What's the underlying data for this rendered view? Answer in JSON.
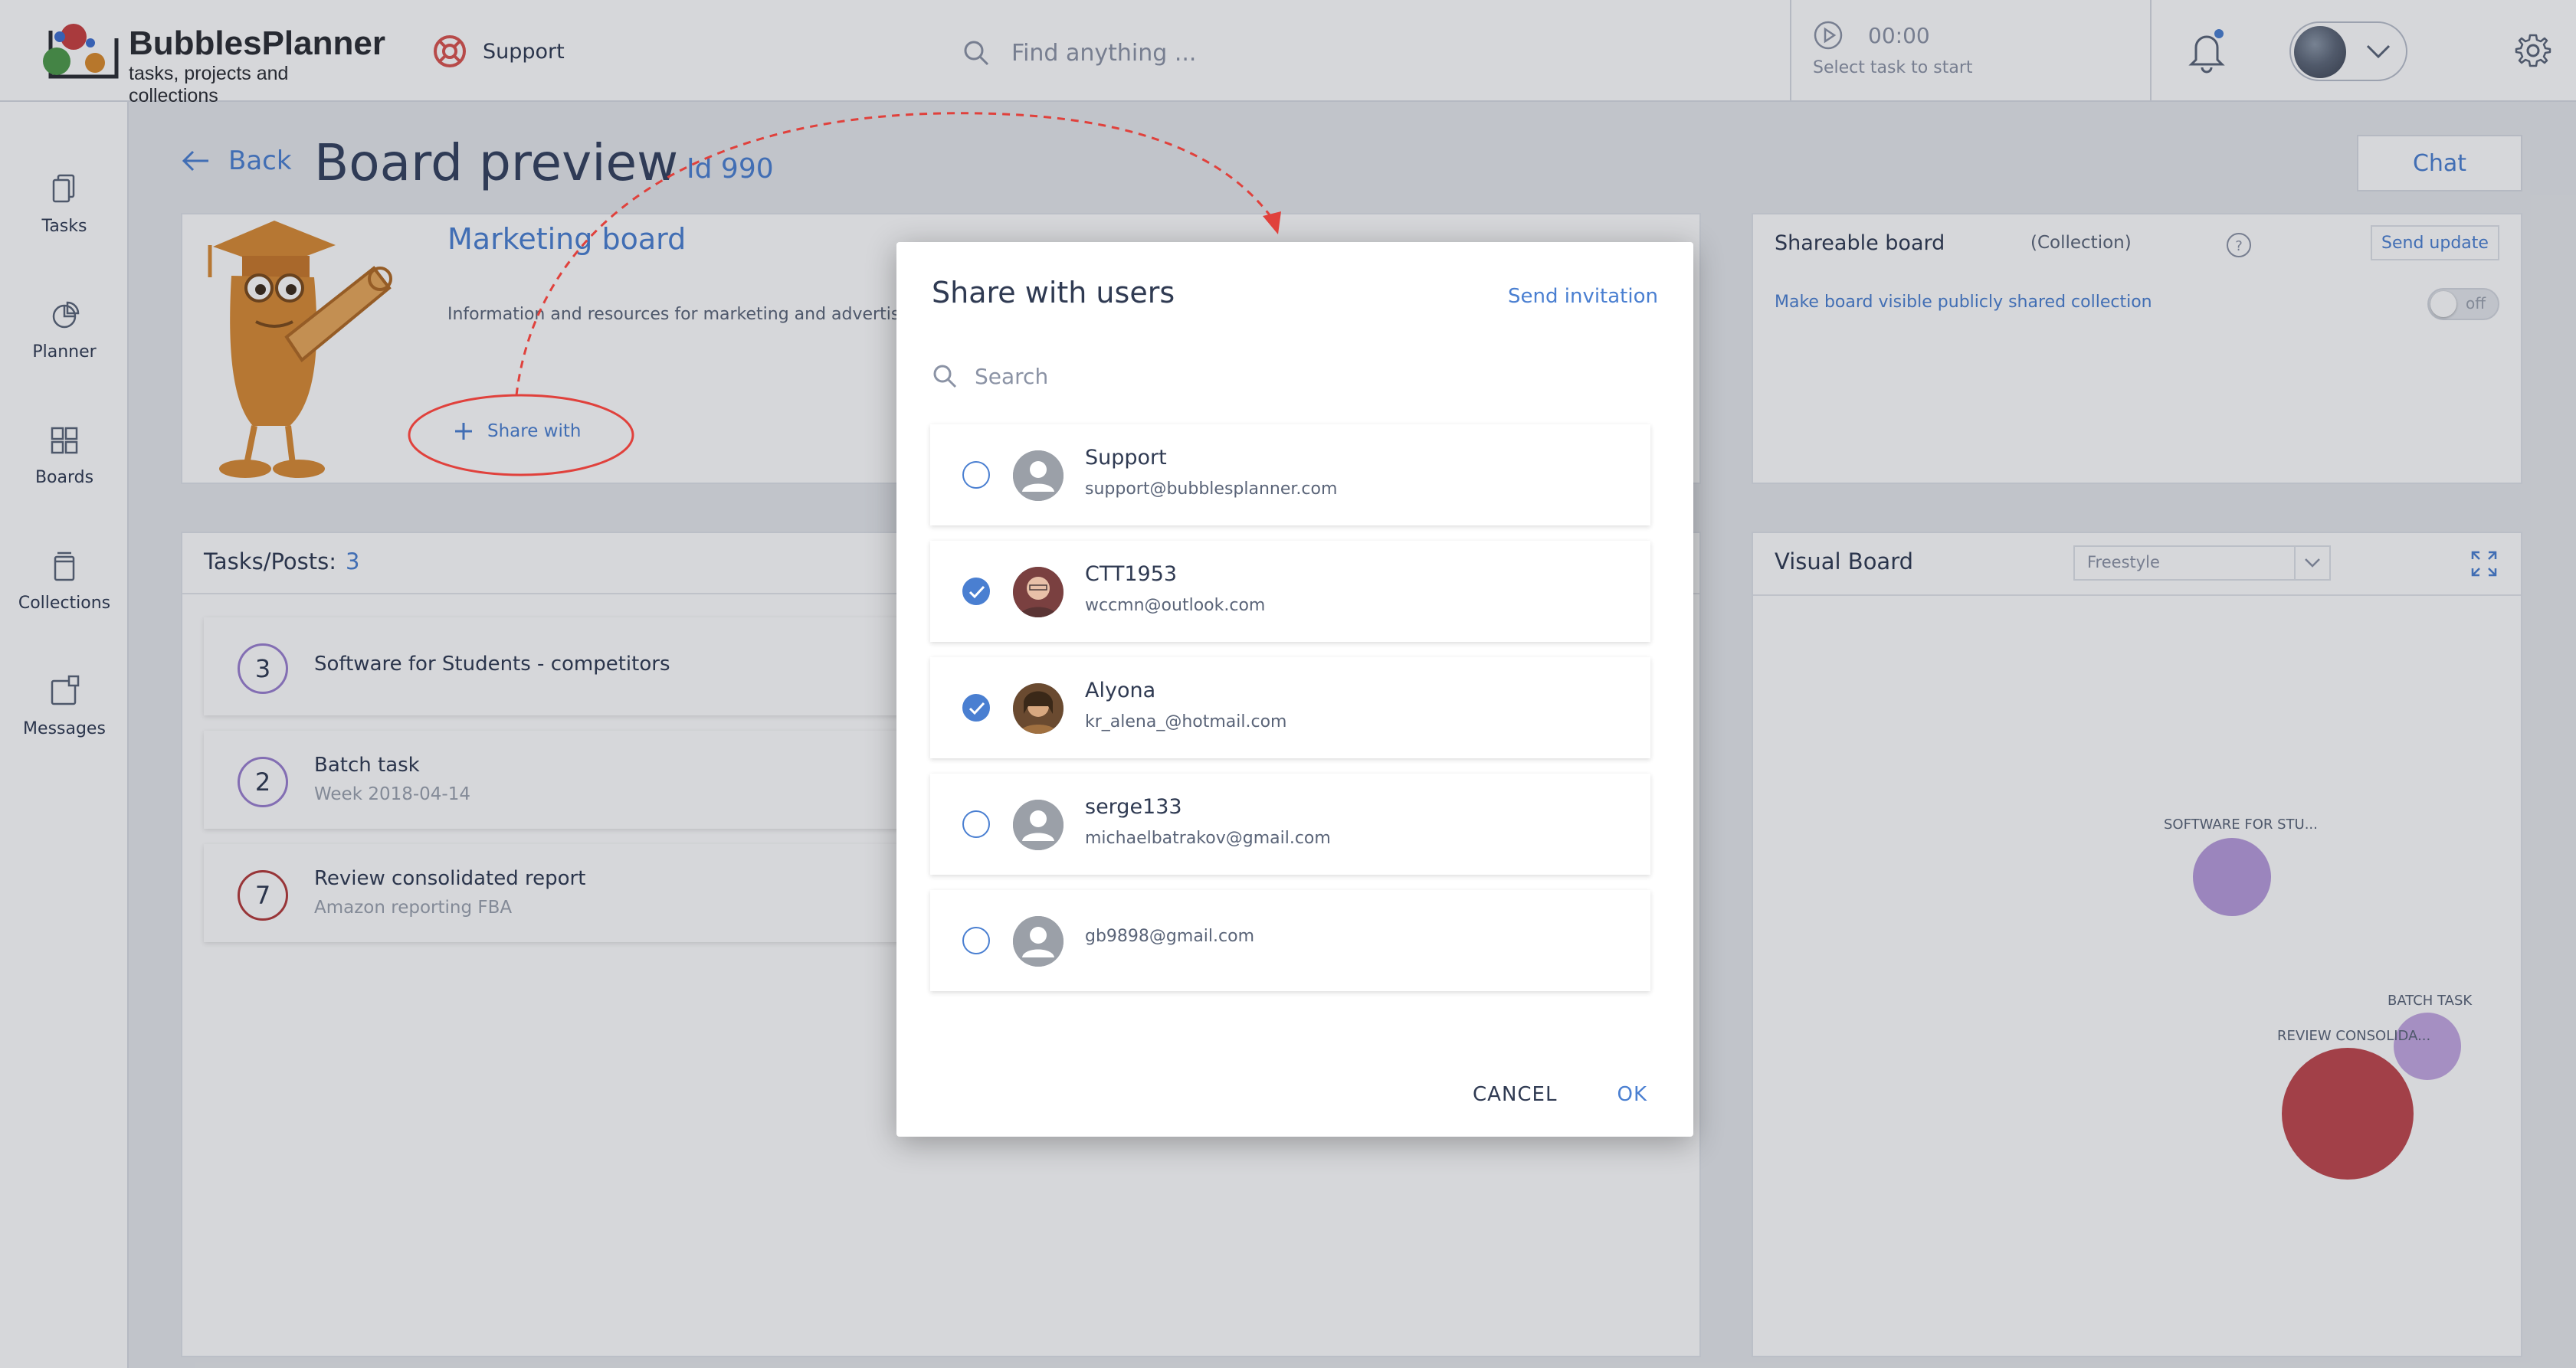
{
  "header": {
    "app_name": "BubblesPlanner",
    "app_tagline": "tasks, projects and collections",
    "support_label": "Support",
    "search_placeholder": "Find anything ...",
    "timer_value": "00:00",
    "timer_hint": "Select task to start"
  },
  "sidebar": {
    "items": [
      {
        "label": "Tasks",
        "icon": "tasks-icon"
      },
      {
        "label": "Planner",
        "icon": "planner-icon"
      },
      {
        "label": "Boards",
        "icon": "boards-icon"
      },
      {
        "label": "Collections",
        "icon": "collections-icon"
      },
      {
        "label": "Messages",
        "icon": "messages-icon"
      }
    ]
  },
  "page": {
    "back_label": "Back",
    "title": "Board preview",
    "id_label": "Id 990",
    "chat_label": "Chat"
  },
  "board": {
    "name": "Marketing board",
    "description": "Information and resources for marketing and advertising",
    "share_with_label": "Share with"
  },
  "tasks": {
    "header_label": "Tasks/Posts:",
    "count": "3",
    "items": [
      {
        "number": "3",
        "title": "Software for Students - competitors",
        "subtitle": ""
      },
      {
        "number": "2",
        "title": "Batch task",
        "subtitle": "Week 2018-04-14"
      },
      {
        "number": "7",
        "title": "Review consolidated report",
        "subtitle": "Amazon reporting FBA"
      }
    ]
  },
  "shareable": {
    "title": "Shareable board",
    "type_label": "(Collection)",
    "send_update_label": "Send update",
    "public_label": "Make board visible publicly shared collection",
    "toggle_label": "off"
  },
  "visual": {
    "title": "Visual Board",
    "mode": "Freestyle",
    "bubbles": [
      {
        "label": "SOFTWARE FOR STU...",
        "color": "#b89cdc"
      },
      {
        "label": "BATCH TASK",
        "color": "#c4a8e2"
      },
      {
        "label": "REVIEW CONSOLIDA...",
        "color": "#c0474d"
      }
    ]
  },
  "modal": {
    "title": "Share with users",
    "send_invitation_label": "Send invitation",
    "search_placeholder": "Search",
    "users": [
      {
        "name": "Support",
        "email": "support@bubblesplanner.com",
        "selected": false
      },
      {
        "name": "CTT1953",
        "email": "wccmn@outlook.com",
        "selected": true
      },
      {
        "name": "Alyona",
        "email": "kr_alena_@hotmail.com",
        "selected": true
      },
      {
        "name": "serge133",
        "email": "michaelbatrakov@gmail.com",
        "selected": false
      },
      {
        "name": "",
        "email": "gb9898@gmail.com",
        "selected": false
      }
    ],
    "cancel_label": "CANCEL",
    "ok_label": "OK"
  },
  "colors": {
    "accent": "#4a7fd1",
    "text": "#2f3a52",
    "annotation": "#e0413c"
  }
}
